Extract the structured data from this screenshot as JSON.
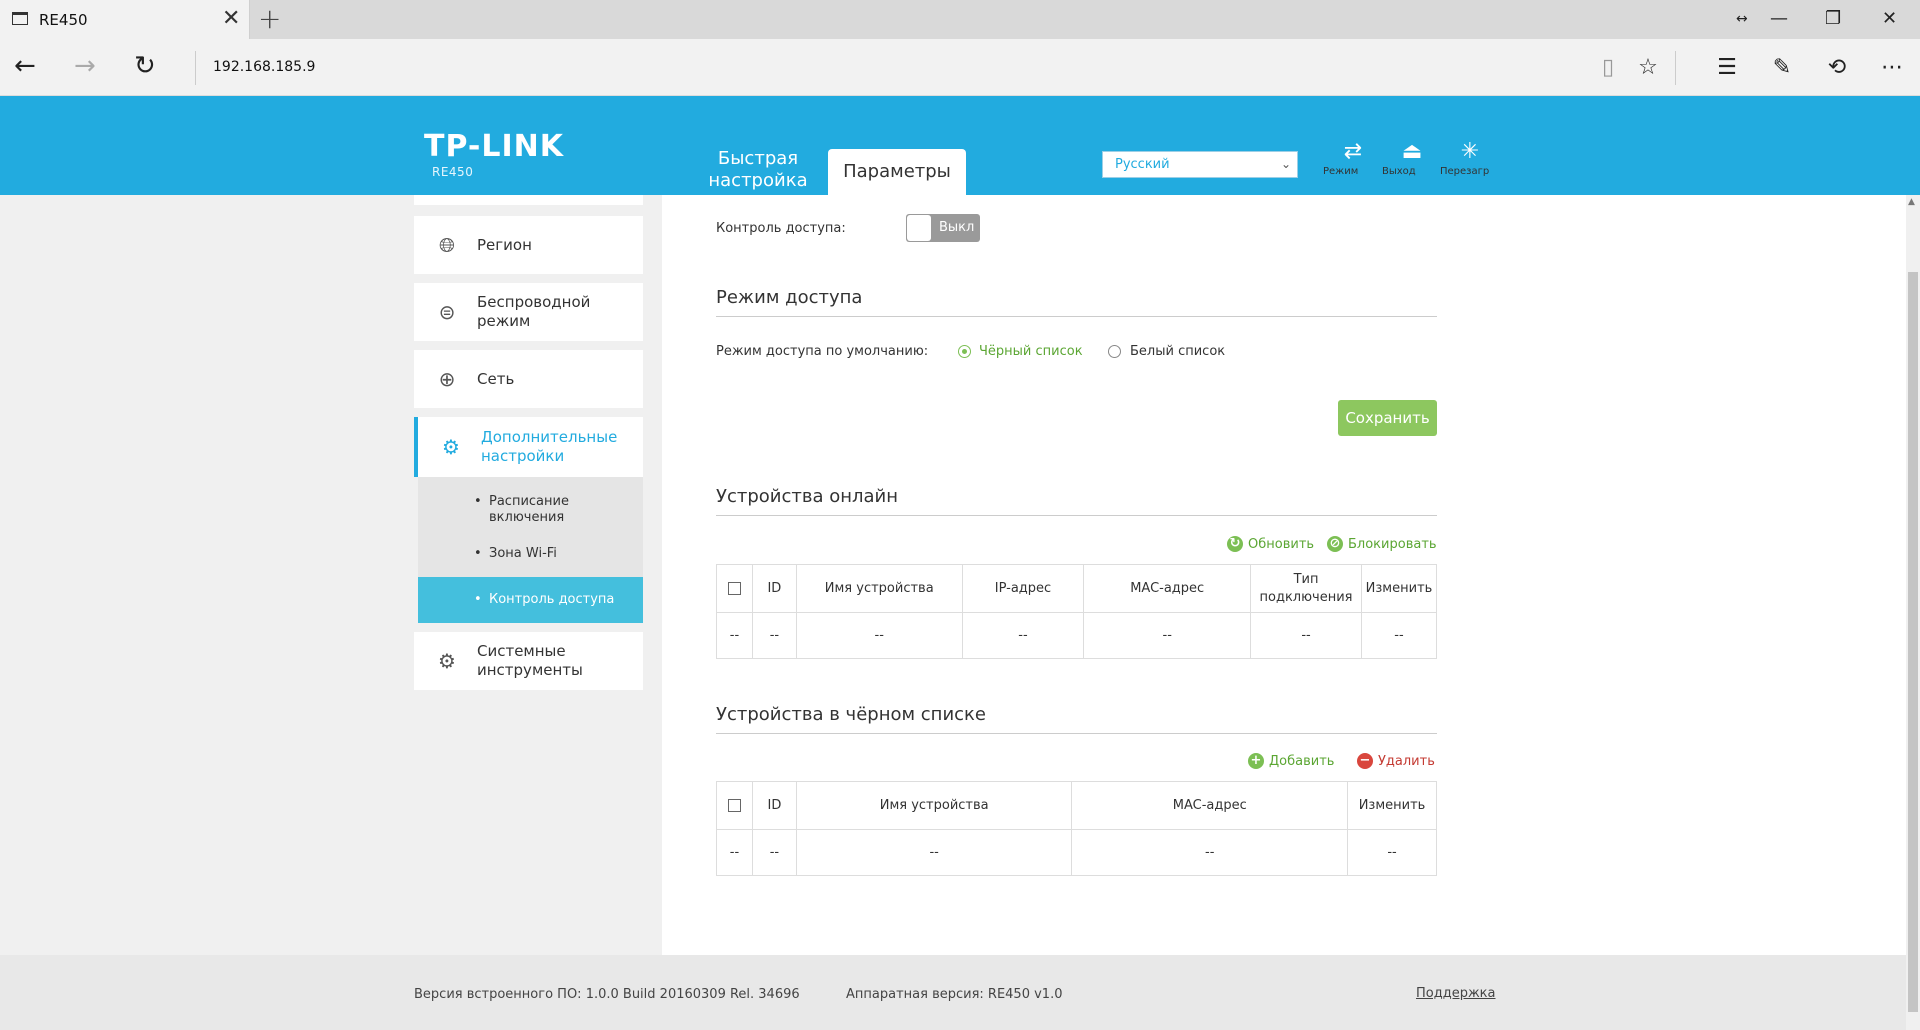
{
  "browser": {
    "tab_title": "RE450",
    "url": "192.168.185.9",
    "icons": [
      "tab-page-icon",
      "close-icon",
      "plus-icon",
      "resize-icon",
      "minimize-icon",
      "restore-icon",
      "window-close-icon",
      "back-icon",
      "forward-icon",
      "refresh-icon",
      "reading-view-icon",
      "favorite-star-icon",
      "hub-icon",
      "web-note-icon",
      "share-icon",
      "more-icon"
    ]
  },
  "header": {
    "logo": "TP-LINK",
    "model": "RE450",
    "tab_quick_line1": "Быстрая",
    "tab_quick_line2": "настройка",
    "tab_params": "Параметры",
    "language": "Русский",
    "mode_label": "Режим",
    "logout_label": "Выход",
    "reboot_label": "Перезагр"
  },
  "sidebar": {
    "items": [
      {
        "line1": "Регион",
        "line2": ""
      },
      {
        "line1": "Беспроводной",
        "line2": "режим"
      },
      {
        "line1": "Сеть",
        "line2": ""
      },
      {
        "line1": "Дополнительные",
        "line2": "настройки"
      },
      {
        "line1": "Системные",
        "line2": "инструменты"
      }
    ],
    "sub_items": [
      {
        "line1": "Расписание",
        "line2": "включения"
      },
      {
        "line1": "Зона Wi-Fi",
        "line2": ""
      },
      {
        "line1": "Контроль доступа",
        "line2": ""
      }
    ],
    "bullet": "•"
  },
  "access_control": {
    "label": "Контроль доступа:",
    "toggle_state": "Выкл"
  },
  "access_mode": {
    "title": "Режим доступа",
    "default_label": "Режим доступа по умолчанию:",
    "blacklist": "Чёрный список",
    "whitelist": "Белый список",
    "selected": "blacklist",
    "save_button": "Сохранить"
  },
  "online_devices": {
    "title": "Устройства онлайн",
    "refresh": "Обновить",
    "block": "Блокировать",
    "headers": [
      "ID",
      "Имя устройства",
      "IP-адрес",
      "MAC-адрес",
      "Тип",
      "подключения",
      "Изменить"
    ],
    "row": [
      "--",
      "--",
      "--",
      "--",
      "--",
      "--",
      "--"
    ]
  },
  "blacklist_devices": {
    "title": "Устройства в чёрном списке",
    "add": "Добавить",
    "delete": "Удалить",
    "headers": [
      "ID",
      "Имя устройства",
      "MAC-адрес",
      "Изменить"
    ],
    "row": [
      "--",
      "--",
      "--",
      "--",
      "--"
    ]
  },
  "footer": {
    "firmware": "Версия встроенного ПО: 1.0.0 Build 20160309 Rel. 34696",
    "hardware": "Аппаратная версия: RE450 v1.0",
    "support": "Поддержка"
  },
  "colors": {
    "header_blue": "#22abdf",
    "save_green": "#8dc75f",
    "action_green": "#5ba633",
    "delete_red": "#c43a32",
    "active_sub": "#44bfdd"
  }
}
